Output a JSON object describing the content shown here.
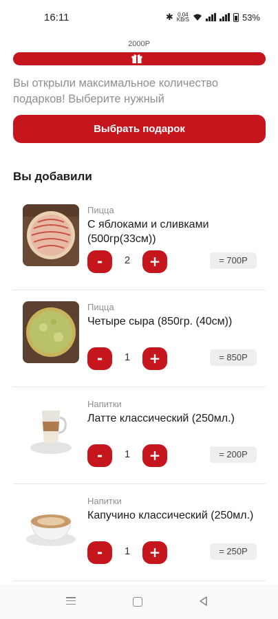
{
  "status_bar": {
    "time": "16:11",
    "net_speed_value": "0.04",
    "net_speed_unit": "KB/S",
    "battery_percent": "53%"
  },
  "progress": {
    "amount": "2000Р",
    "fill_fraction": 1.0
  },
  "gift": {
    "message": "Вы открыли максимальное количество подарков! Выберите нужный",
    "button_label": "Выбрать подарок"
  },
  "cart": {
    "section_title": "Вы добавили",
    "items": [
      {
        "category": "Пицца",
        "name": "С яблоками и сливками (500гр(33см))",
        "quantity": "2",
        "price": "= 700Р",
        "image": "pizza-apple-icon"
      },
      {
        "category": "Пицца",
        "name": "Четыре сыра (850гр. (40см))",
        "quantity": "1",
        "price": "= 850Р",
        "image": "pizza-cheese-icon"
      },
      {
        "category": "Напитки",
        "name": "Латте классический (250мл.)",
        "quantity": "1",
        "price": "= 200Р",
        "image": "latte-glass-icon"
      },
      {
        "category": "Напитки",
        "name": "Капучино классический (250мл.)",
        "quantity": "1",
        "price": "= 250Р",
        "image": "cappuccino-cup-icon"
      }
    ],
    "minus_label": "-",
    "plus_label": "+"
  },
  "colors": {
    "accent": "#c4161c",
    "track": "#7d7d7d",
    "muted_text": "#8f8f8f"
  }
}
